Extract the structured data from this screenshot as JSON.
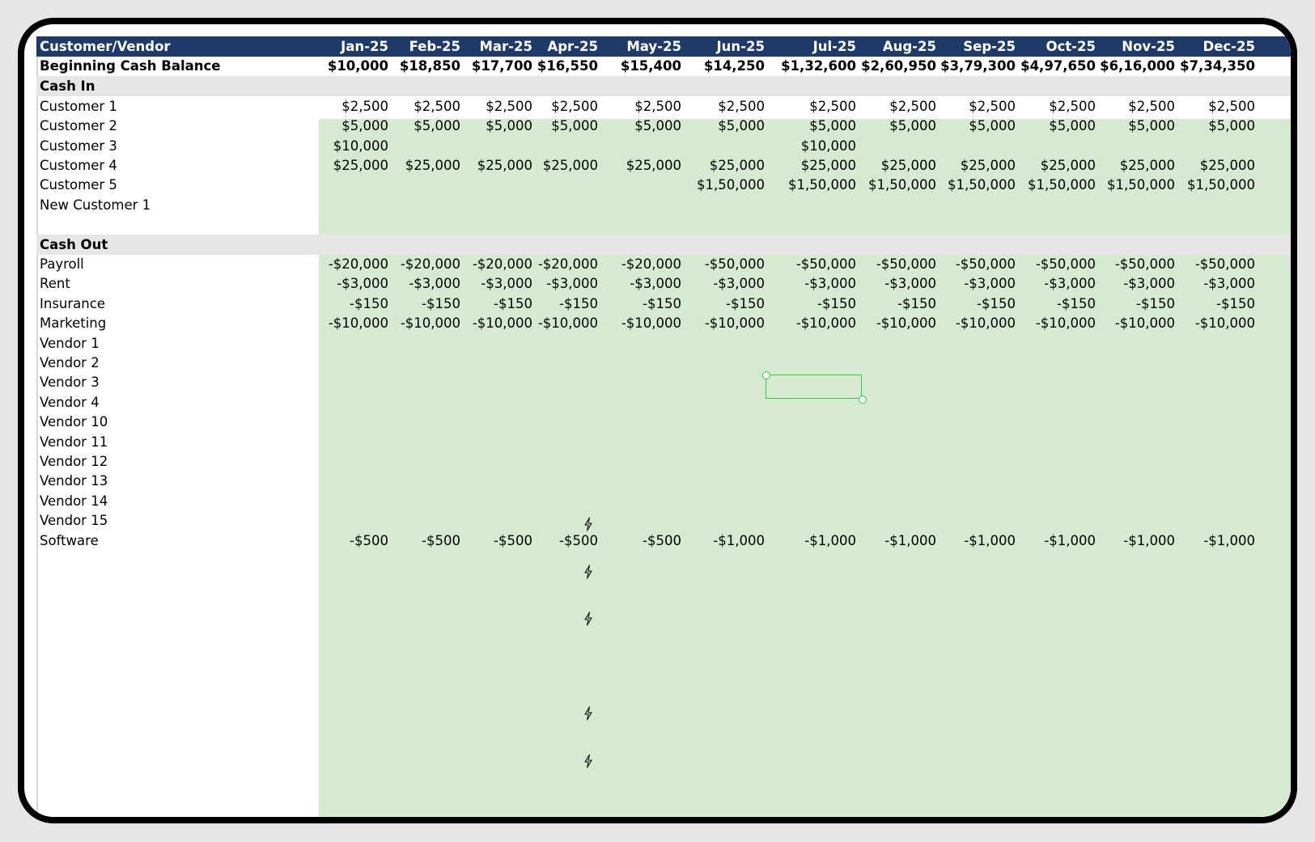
{
  "sheet": {
    "header": {
      "label": "Customer/Vendor",
      "months": [
        "Jan-25",
        "Feb-25",
        "Mar-25",
        "Apr-25",
        "May-25",
        "Jun-25",
        "Jul-25",
        "Aug-25",
        "Sep-25",
        "Oct-25",
        "Nov-25",
        "Dec-25"
      ]
    },
    "beginning_balance": {
      "label": "Beginning Cash Balance",
      "values": [
        "$10,000",
        "$18,850",
        "$17,700",
        "$16,550",
        "$15,400",
        "$14,250",
        "$1,32,600",
        "$2,60,950",
        "$3,79,300",
        "$4,97,650",
        "$6,16,000",
        "$7,34,350"
      ]
    },
    "cash_in": {
      "label": "Cash In",
      "rows": [
        {
          "label": "Customer 1",
          "values": [
            "$2,500",
            "$2,500",
            "$2,500",
            "$2,500",
            "$2,500",
            "$2,500",
            "$2,500",
            "$2,500",
            "$2,500",
            "$2,500",
            "$2,500",
            "$2,500"
          ]
        },
        {
          "label": "Customer 2",
          "values": [
            "$5,000",
            "$5,000",
            "$5,000",
            "$5,000",
            "$5,000",
            "$5,000",
            "$5,000",
            "$5,000",
            "$5,000",
            "$5,000",
            "$5,000",
            "$5,000"
          ]
        },
        {
          "label": "Customer 3",
          "values": [
            "$10,000",
            "",
            "",
            "",
            "",
            "",
            "$10,000",
            "",
            "",
            "",
            "",
            ""
          ]
        },
        {
          "label": "Customer 4",
          "values": [
            "$25,000",
            "$25,000",
            "$25,000",
            "$25,000",
            "$25,000",
            "$25,000",
            "$25,000",
            "$25,000",
            "$25,000",
            "$25,000",
            "$25,000",
            "$25,000"
          ]
        },
        {
          "label": "Customer 5",
          "values": [
            "",
            "",
            "",
            "",
            "",
            "$1,50,000",
            "$1,50,000",
            "$1,50,000",
            "$1,50,000",
            "$1,50,000",
            "$1,50,000",
            "$1,50,000"
          ]
        },
        {
          "label": "New Customer 1",
          "values": [
            "",
            "",
            "",
            "",
            "",
            "",
            "",
            "",
            "",
            "",
            "",
            ""
          ]
        }
      ]
    },
    "cash_out": {
      "label": "Cash Out",
      "rows": [
        {
          "label": "Payroll",
          "values": [
            "-$20,000",
            "-$20,000",
            "-$20,000",
            "-$20,000",
            "-$20,000",
            "-$50,000",
            "-$50,000",
            "-$50,000",
            "-$50,000",
            "-$50,000",
            "-$50,000",
            "-$50,000"
          ]
        },
        {
          "label": "Rent",
          "values": [
            "-$3,000",
            "-$3,000",
            "-$3,000",
            "-$3,000",
            "-$3,000",
            "-$3,000",
            "-$3,000",
            "-$3,000",
            "-$3,000",
            "-$3,000",
            "-$3,000",
            "-$3,000"
          ]
        },
        {
          "label": "Insurance",
          "values": [
            "-$150",
            "-$150",
            "-$150",
            "-$150",
            "-$150",
            "-$150",
            "-$150",
            "-$150",
            "-$150",
            "-$150",
            "-$150",
            "-$150"
          ]
        },
        {
          "label": "Marketing",
          "values": [
            "-$10,000",
            "-$10,000",
            "-$10,000",
            "-$10,000",
            "-$10,000",
            "-$10,000",
            "-$10,000",
            "-$10,000",
            "-$10,000",
            "-$10,000",
            "-$10,000",
            "-$10,000"
          ]
        },
        {
          "label": "Vendor 1",
          "values": [
            "",
            "",
            "",
            "",
            "",
            "",
            "",
            "",
            "",
            "",
            "",
            ""
          ]
        },
        {
          "label": "Vendor 2",
          "values": [
            "",
            "",
            "",
            "",
            "",
            "",
            "",
            "",
            "",
            "",
            "",
            ""
          ]
        },
        {
          "label": "Vendor 3",
          "values": [
            "",
            "",
            "",
            "",
            "",
            "",
            "",
            "",
            "",
            "",
            "",
            ""
          ]
        },
        {
          "label": "Vendor 4",
          "values": [
            "",
            "",
            "",
            "",
            "",
            "",
            "",
            "",
            "",
            "",
            "",
            ""
          ]
        },
        {
          "label": "Vendor 10",
          "values": [
            "",
            "",
            "",
            "",
            "",
            "",
            "",
            "",
            "",
            "",
            "",
            ""
          ]
        },
        {
          "label": "Vendor 11",
          "values": [
            "",
            "",
            "",
            "",
            "",
            "",
            "",
            "",
            "",
            "",
            "",
            ""
          ]
        },
        {
          "label": "Vendor 12",
          "values": [
            "",
            "",
            "",
            "",
            "",
            "",
            "",
            "",
            "",
            "",
            "",
            ""
          ]
        },
        {
          "label": "Vendor 13",
          "values": [
            "",
            "",
            "",
            "",
            "",
            "",
            "",
            "",
            "",
            "",
            "",
            ""
          ]
        },
        {
          "label": "Vendor 14",
          "values": [
            "",
            "",
            "",
            "",
            "",
            "",
            "",
            "",
            "",
            "",
            "",
            ""
          ]
        },
        {
          "label": "Vendor 15",
          "values": [
            "",
            "",
            "",
            "",
            "",
            "",
            "",
            "",
            "",
            "",
            "",
            ""
          ]
        },
        {
          "label": "Software",
          "values": [
            "-$500",
            "-$500",
            "-$500",
            "-$500",
            "-$500",
            "-$1,000",
            "-$1,000",
            "-$1,000",
            "-$1,000",
            "-$1,000",
            "-$1,000",
            "-$1,000"
          ]
        }
      ]
    },
    "colors": {
      "header_bg": "#1f3a68",
      "green_fill": "#d6ead2",
      "section_bg": "#e6e6e6",
      "selection": "#2ecc40"
    },
    "icons": [
      "lightning-bolt-icon"
    ]
  }
}
